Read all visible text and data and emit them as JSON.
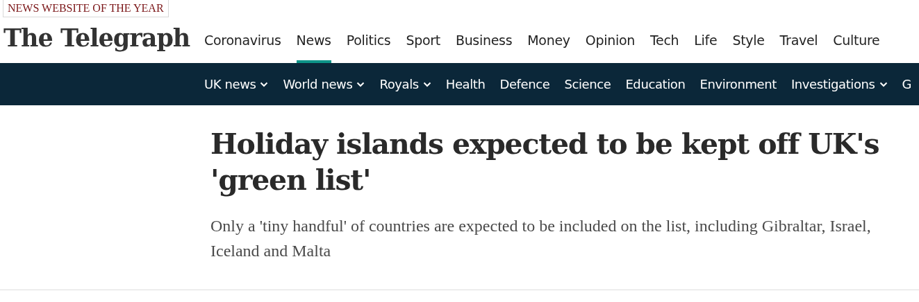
{
  "award_banner": "NEWS WEBSITE OF THE YEAR",
  "logo": "The Telegraph",
  "main_nav": [
    {
      "label": "Coronavirus",
      "selected": false
    },
    {
      "label": "News",
      "selected": true
    },
    {
      "label": "Politics",
      "selected": false
    },
    {
      "label": "Sport",
      "selected": false
    },
    {
      "label": "Business",
      "selected": false
    },
    {
      "label": "Money",
      "selected": false
    },
    {
      "label": "Opinion",
      "selected": false
    },
    {
      "label": "Tech",
      "selected": false
    },
    {
      "label": "Life",
      "selected": false
    },
    {
      "label": "Style",
      "selected": false
    },
    {
      "label": "Travel",
      "selected": false
    },
    {
      "label": "Culture",
      "selected": false
    }
  ],
  "sub_nav": [
    {
      "label": "UK news",
      "dropdown": true
    },
    {
      "label": "World news",
      "dropdown": true
    },
    {
      "label": "Royals",
      "dropdown": true
    },
    {
      "label": "Health",
      "dropdown": false
    },
    {
      "label": "Defence",
      "dropdown": false
    },
    {
      "label": "Science",
      "dropdown": false
    },
    {
      "label": "Education",
      "dropdown": false
    },
    {
      "label": "Environment",
      "dropdown": false
    },
    {
      "label": "Investigations",
      "dropdown": true
    },
    {
      "label": "G",
      "dropdown": false
    }
  ],
  "article": {
    "headline": "Holiday islands expected to be kept off UK's 'green list'",
    "standfirst": "Only a 'tiny handful' of countries are expected to be included on the list, including Gibraltar, Israel, Iceland and Malta"
  }
}
